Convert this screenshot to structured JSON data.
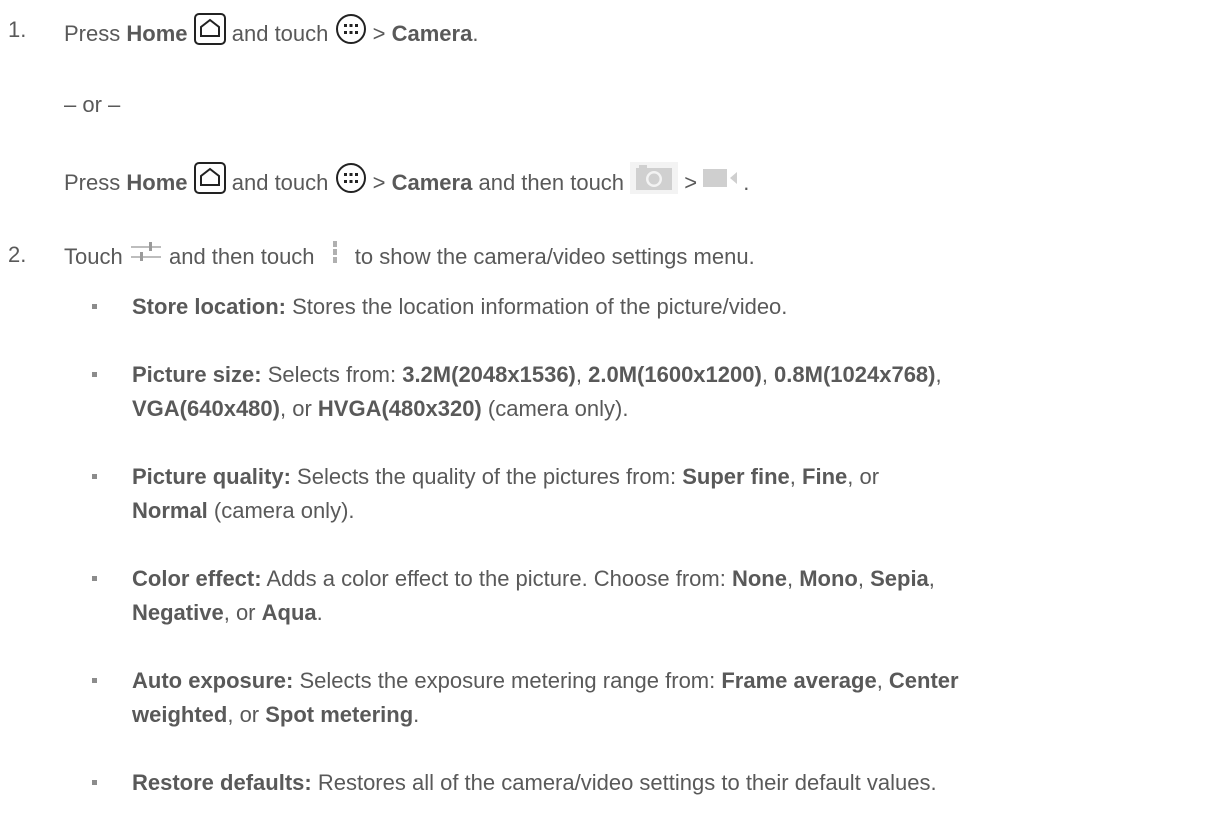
{
  "step1": {
    "number": "1.",
    "press": "Press",
    "home": "Home",
    "and_touch": "and touch",
    "gt": ">",
    "camera": "Camera",
    "period": ".",
    "or": "– or –"
  },
  "step1b": {
    "press": "Press",
    "home": "Home",
    "and_touch": "and touch",
    "gt": ">",
    "camera": "Camera",
    "and_then_touch": "and then touch",
    "gt2": ">",
    "period": "."
  },
  "step2": {
    "number": "2.",
    "touch": "Touch",
    "and_then_touch": "and then touch",
    "rest": "to show the camera/video settings menu."
  },
  "settings": [
    {
      "name": "Store location:",
      "text": " Stores the location information of the picture/video."
    },
    {
      "name": "Picture size:",
      "text1": " Selects from: ",
      "o1": "3.2M(2048x1536)",
      "s1": ", ",
      "o2": "2.0M(1600x1200)",
      "s2": ", ",
      "o3": "0.8M(1024x768)",
      "s3": ",",
      "o4": "VGA(640x480)",
      "s4": ", or ",
      "o5": "HVGA(480x320)",
      "s5": " (camera only)."
    },
    {
      "name": "Picture quality:",
      "text1": " Selects the quality of the pictures from: ",
      "o1": "Super fine",
      "s1": ", ",
      "o2": "Fine",
      "s2": ", or",
      "o3": "Normal",
      "s3": " (camera only)."
    },
    {
      "name": "Color effect:",
      "text1": " Adds a color effect to the picture. Choose from: ",
      "o1": "None",
      "s1": ", ",
      "o2": "Mono",
      "s2": ", ",
      "o3": "Sepia",
      "s3": ",",
      "o4": "Negative",
      "s4": ", or ",
      "o5": "Aqua",
      "s5": "."
    },
    {
      "name": "Auto exposure:",
      "text1": " Selects the exposure metering range from: ",
      "o1": "Frame average",
      "s1": ", ",
      "o2": "Center",
      "o2b": "weighted",
      "s2": ", or ",
      "o3": "Spot metering",
      "s3": "."
    },
    {
      "name": "Restore defaults:",
      "text": " Restores all of the camera/video settings to their default values."
    }
  ]
}
